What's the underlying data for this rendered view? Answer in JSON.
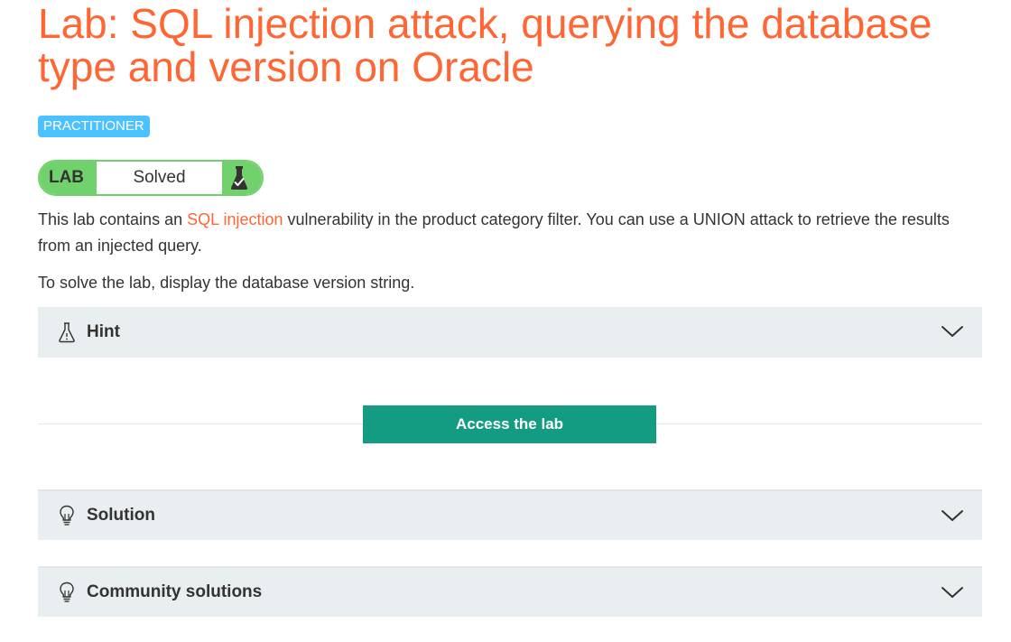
{
  "title": "Lab: SQL injection attack, querying the database type and version on Oracle",
  "level": "PRACTITIONER",
  "status": {
    "label": "LAB",
    "text": "Solved"
  },
  "description": {
    "intro": "This lab contains an ",
    "link_text": "SQL injection",
    "rest": " vulnerability in the product category filter. You can use a UNION attack to retrieve the results from an injected query.",
    "task": "To solve the lab, display the database version string."
  },
  "sections": {
    "hint": "Hint",
    "solution": "Solution",
    "community": "Community solutions"
  },
  "access_button": "Access the lab",
  "colors": {
    "title": "#ff6633",
    "badge": "#4cc1ff",
    "solved": "#70d16d",
    "button": "#149c82",
    "panel": "#e9eef1"
  },
  "icons": {
    "status": "flask-check-icon",
    "hint": "flask-icon",
    "solution": "lightbulb-icon",
    "community": "lightbulb-icon",
    "expand": "chevron-down-icon"
  }
}
